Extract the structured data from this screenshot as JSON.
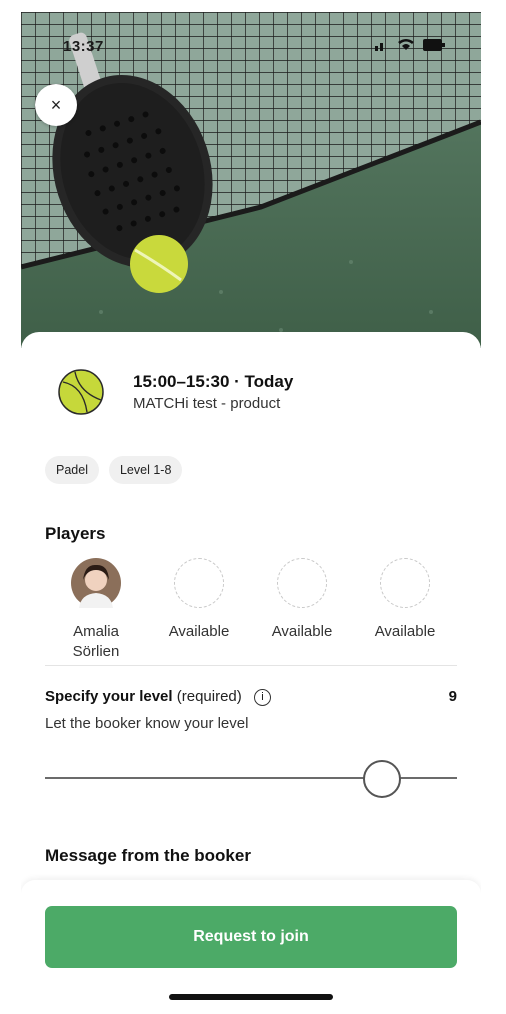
{
  "status_bar": {
    "time": "13:37"
  },
  "header": {
    "close_label": "×"
  },
  "match": {
    "time": "15:00–15:30 · Today",
    "club": "MATCHi test - product"
  },
  "tags": [
    "Padel",
    "Level 1-8"
  ],
  "players": {
    "title": "Players",
    "slots": [
      {
        "name": "Amalia\nSörlien",
        "filled": true
      },
      {
        "name": "Available",
        "filled": false
      },
      {
        "name": "Available",
        "filled": false
      },
      {
        "name": "Available",
        "filled": false
      }
    ]
  },
  "level": {
    "label_bold": "Specify your level",
    "label_suffix": "(required)",
    "info_icon": "i",
    "value": "9",
    "hint": "Let the booker know your level",
    "slider_fraction": 0.85
  },
  "message": {
    "title": "Message from the booker"
  },
  "cta": {
    "label": "Request to join"
  },
  "colors": {
    "primary": "#4caa67",
    "ball": "#c6d83a"
  }
}
